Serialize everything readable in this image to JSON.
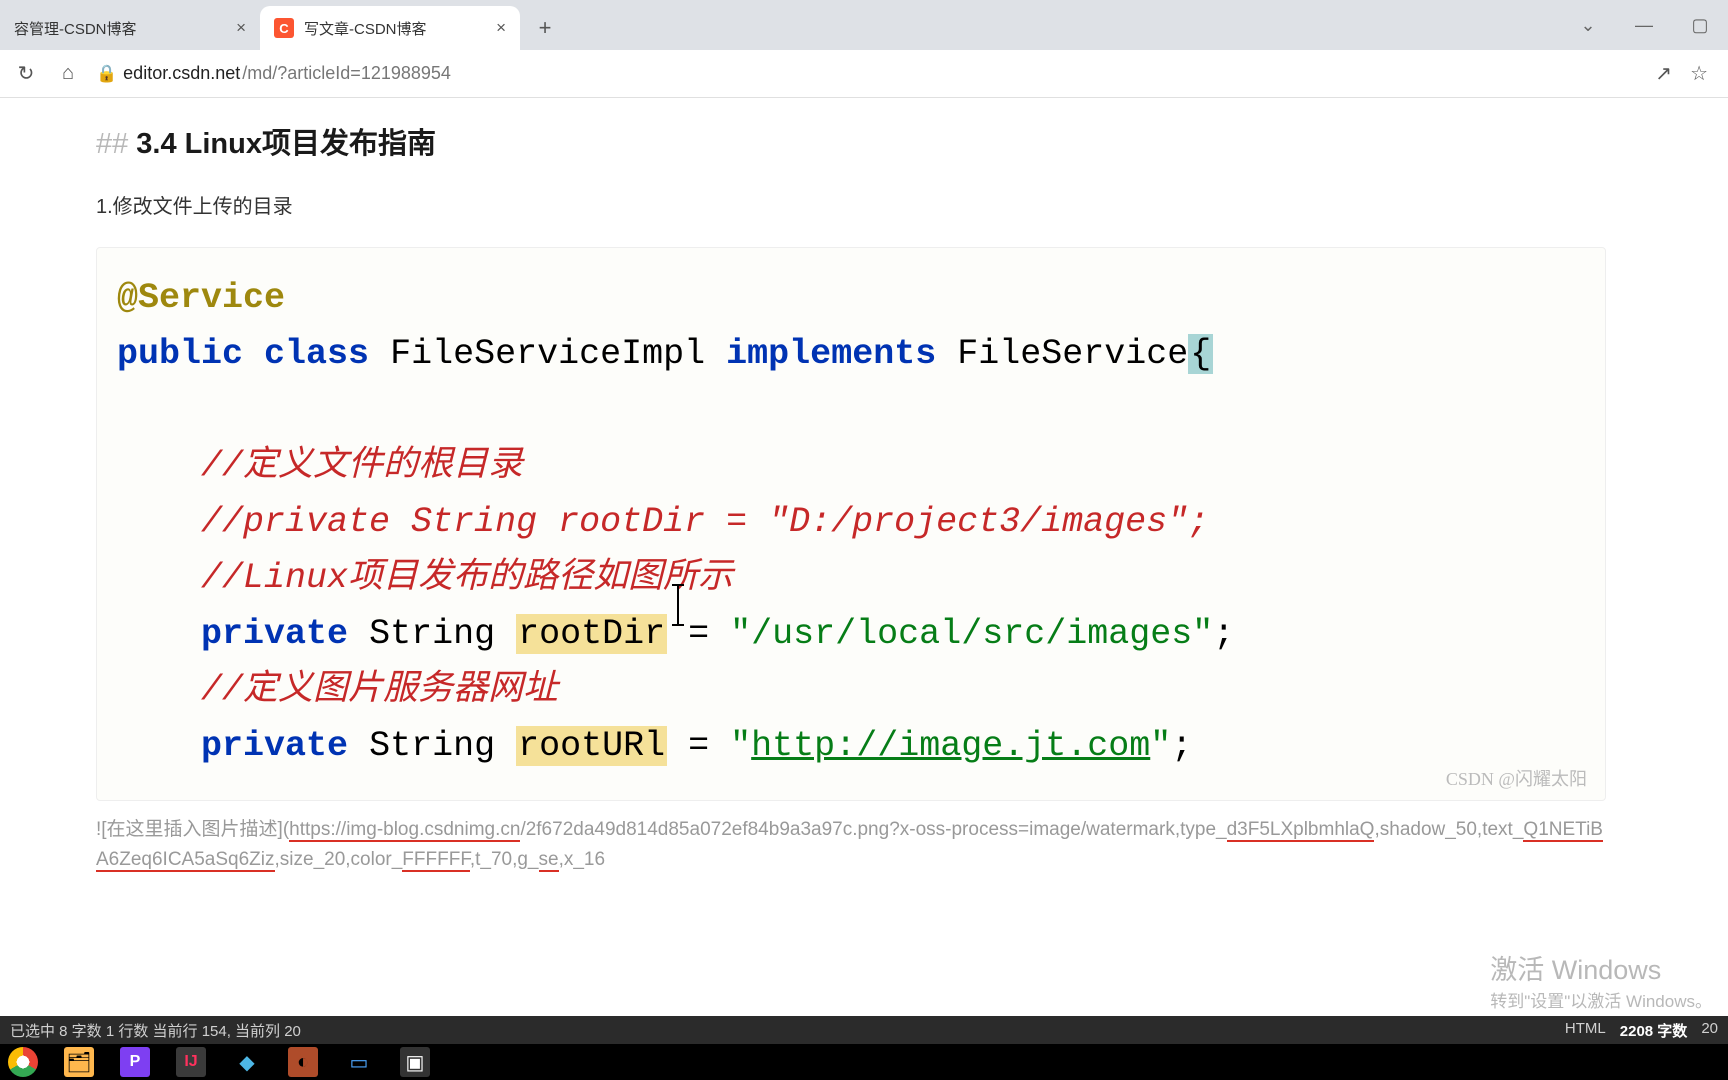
{
  "tabs": {
    "inactive_title": "容管理-CSDN博客",
    "active_title": "写文章-CSDN博客"
  },
  "address": {
    "host": "editor.csdn.net",
    "path": "/md/?articleId=121988954"
  },
  "editor": {
    "heading_prefix": "##",
    "heading": "3.4 Linux项目发布指南",
    "paragraph": "1.修改文件上传的目录"
  },
  "code": {
    "annotation": "@Service",
    "kw_public": "public",
    "kw_class": "class",
    "class_name": "FileServiceImpl",
    "kw_implements": "implements",
    "iface_name": "FileService",
    "brace": "{",
    "comment1": "//定义文件的根目录",
    "comment2": "//private String rootDir = \"D:/project3/images\";",
    "comment3": "//Linux项目发布的路径如图所示",
    "kw_private": "private",
    "type_string": "String",
    "var_rootDir": "rootDir",
    "eq": " = ",
    "val_rootDir": "\"/usr/local/src/images\"",
    "semi": ";",
    "comment4": "//定义图片服务器网址",
    "var_rootURL": "rootURl",
    "val_rootURL_q1": "\"",
    "val_rootURL_link": "http://image.jt.com",
    "val_rootURL_q2": "\"",
    "watermark": "CSDN @闪耀太阳"
  },
  "imglink": {
    "prefix": "![在这里插入图片描述](",
    "u1": "https://img-blog.csdnimg.cn",
    "u2": "/2f672da49d814d85a072ef84b9a3a97c.png",
    "u3": "?x-oss-process=image/watermark,type_",
    "u4": "d3F5LXplbmhlaQ",
    "u5": ",shadow_50,text_",
    "u6": "Q1NETiBA6Zeq6ICA5aSq6Ziz",
    "u7": ",size_20,color_",
    "u8": "FFFFFF",
    "u9": ",t_70,g_",
    "u10": "se",
    "u11": ",x_16"
  },
  "activate": {
    "line1": "激活 Windows",
    "line2": "转到\"设置\"以激活 Windows。"
  },
  "status": {
    "left": "已选中  8 字数  1 行数  当前行 154, 当前列 20",
    "mode": "HTML",
    "words": "2208 字数",
    "right": "20"
  }
}
